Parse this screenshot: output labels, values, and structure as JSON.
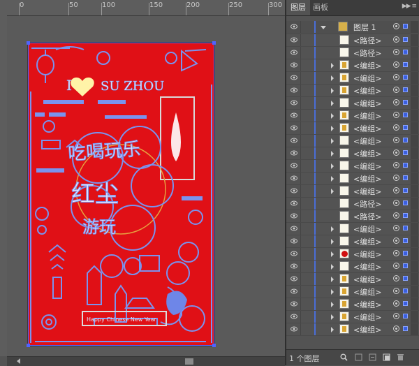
{
  "ruler": {
    "ticks": [
      "0",
      "50",
      "100",
      "150",
      "200",
      "250",
      "300"
    ]
  },
  "artwork": {
    "heading": "I",
    "heading2": "SU ZHOU",
    "calligraphy": "吃喝玩乐",
    "calligraphy2": "红尘",
    "calligraphy3": "游玩",
    "banner": "Happy Chinese New Year",
    "colors": {
      "background": "#e01016",
      "line": "#6e86e8",
      "heart": "#fff3a8"
    }
  },
  "panel": {
    "tabs": [
      "图层",
      "画板"
    ],
    "menu_icon": "panel-menu-icon",
    "layer_name": "图层 1",
    "rows": [
      {
        "label": "<路径>",
        "arrow": false,
        "thumb": "blank"
      },
      {
        "label": "<路径>",
        "arrow": false,
        "thumb": "blank"
      },
      {
        "label": "<编组>",
        "arrow": true,
        "thumb": "gold"
      },
      {
        "label": "<编组>",
        "arrow": true,
        "thumb": "gold"
      },
      {
        "label": "<编组>",
        "arrow": true,
        "thumb": "gold"
      },
      {
        "label": "<编组>",
        "arrow": true,
        "thumb": "blank"
      },
      {
        "label": "<编组>",
        "arrow": true,
        "thumb": "gold"
      },
      {
        "label": "<编组>",
        "arrow": true,
        "thumb": "gold"
      },
      {
        "label": "<编组>",
        "arrow": true,
        "thumb": "blank"
      },
      {
        "label": "<编组>",
        "arrow": true,
        "thumb": "blank"
      },
      {
        "label": "<编组>",
        "arrow": true,
        "thumb": "blank"
      },
      {
        "label": "<编组>",
        "arrow": true,
        "thumb": "blank"
      },
      {
        "label": "<编组>",
        "arrow": true,
        "thumb": "blank"
      },
      {
        "label": "<路径>",
        "arrow": false,
        "thumb": "blank"
      },
      {
        "label": "<路径>",
        "arrow": false,
        "thumb": "blank"
      },
      {
        "label": "<编组>",
        "arrow": true,
        "thumb": "blank"
      },
      {
        "label": "<编组>",
        "arrow": true,
        "thumb": "blank"
      },
      {
        "label": "<编组>",
        "arrow": true,
        "thumb": "red"
      },
      {
        "label": "<编组>",
        "arrow": true,
        "thumb": "blank"
      },
      {
        "label": "<编组>",
        "arrow": true,
        "thumb": "gold"
      },
      {
        "label": "<编组>",
        "arrow": true,
        "thumb": "gold"
      },
      {
        "label": "<编组>",
        "arrow": true,
        "thumb": "gold"
      },
      {
        "label": "<编组>",
        "arrow": true,
        "thumb": "gold"
      },
      {
        "label": "<编组>",
        "arrow": true,
        "thumb": "gold"
      }
    ],
    "footer": {
      "count_label": "1 个图层"
    }
  }
}
